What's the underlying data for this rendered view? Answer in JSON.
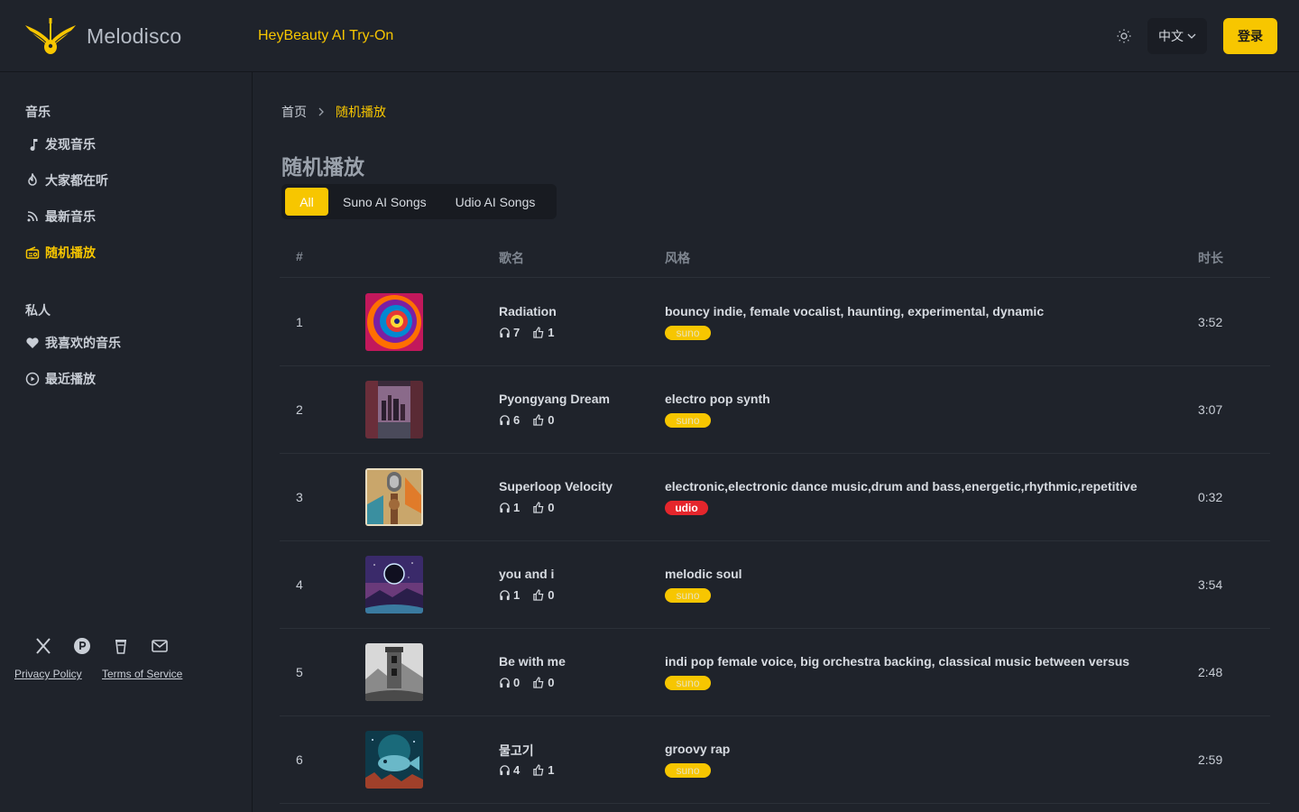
{
  "header": {
    "brand": "Melodisco",
    "promo": "HeyBeauty AI Try-On",
    "language": "中文",
    "login": "登录",
    "logo_color": "#f7c600"
  },
  "sidebar": {
    "music_section": "音乐",
    "items": [
      {
        "label": "发现音乐",
        "icon": "music-note-icon"
      },
      {
        "label": "大家都在听",
        "icon": "fire-icon"
      },
      {
        "label": "最新音乐",
        "icon": "rss-icon"
      },
      {
        "label": "随机播放",
        "icon": "radio-icon",
        "active": true
      }
    ],
    "private_section": "私人",
    "private_items": [
      {
        "label": "我喜欢的音乐",
        "icon": "heart-icon"
      },
      {
        "label": "最近播放",
        "icon": "play-circle-icon"
      }
    ],
    "social_icons": [
      "x-icon",
      "producthunt-icon",
      "buymeacoffee-icon",
      "mail-icon"
    ],
    "privacy": "Privacy Policy",
    "terms": "Terms of Service"
  },
  "main": {
    "breadcrumb_home": "首页",
    "breadcrumb_current": "随机播放",
    "title": "随机播放",
    "tabs": [
      "All",
      "Suno AI Songs",
      "Udio AI Songs"
    ],
    "columns": {
      "num": "#",
      "name": "歌名",
      "style": "风格",
      "duration": "时长"
    },
    "songs": [
      {
        "num": "1",
        "name": "Radiation",
        "plays": "7",
        "likes": "1",
        "style": "bouncy indie, female vocalist, haunting, experimental, dynamic",
        "source": "suno",
        "duration": "3:52"
      },
      {
        "num": "2",
        "name": "Pyongyang Dream",
        "plays": "6",
        "likes": "0",
        "style": "electro pop synth",
        "source": "suno",
        "duration": "3:07"
      },
      {
        "num": "3",
        "name": "Superloop Velocity",
        "plays": "1",
        "likes": "0",
        "style": "electronic,electronic dance music,drum and bass,energetic,rhythmic,repetitive",
        "source": "udio",
        "duration": "0:32"
      },
      {
        "num": "4",
        "name": "you and i",
        "plays": "1",
        "likes": "0",
        "style": "melodic soul",
        "source": "suno",
        "duration": "3:54"
      },
      {
        "num": "5",
        "name": "Be with me",
        "plays": "0",
        "likes": "0",
        "style": "indi pop female voice, big orchestra backing, classical music between versus",
        "source": "suno",
        "duration": "2:48"
      },
      {
        "num": "6",
        "name": "물고기",
        "plays": "4",
        "likes": "1",
        "style": "groovy rap",
        "source": "suno",
        "duration": "2:59"
      }
    ]
  },
  "colors": {
    "accent": "#f7c600",
    "udio": "#e5262c",
    "background": "#1f232b"
  }
}
